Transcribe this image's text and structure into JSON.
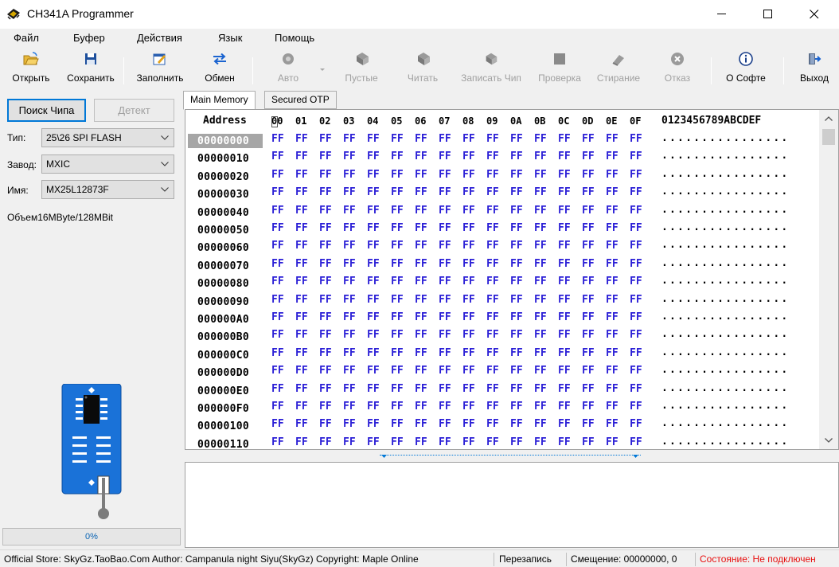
{
  "window": {
    "title": "CH341A Programmer"
  },
  "menu": [
    "Файл",
    "Буфер",
    "Действия",
    "Язык",
    "Помощь"
  ],
  "toolbar": {
    "open": "Открыть",
    "save": "Сохранить",
    "fill": "Заполнить",
    "swap": "Обмен",
    "auto": "Авто",
    "blank": "Пустые",
    "read": "Читать",
    "write": "Записать Чип",
    "verify": "Проверка",
    "erase": "Стирание",
    "cancel": "Отказ",
    "about": "О Софте",
    "exit": "Выход"
  },
  "chip": {
    "search_button": "Поиск Чипа",
    "detect_button": "Детект",
    "type_label": "Тип:",
    "type_value": "25\\26 SPI FLASH",
    "vendor_label": "Завод:",
    "vendor_value": "MXIC",
    "name_label": "Имя:",
    "name_value": "MX25L12873F",
    "capacity": "Объем16MByte/128MBit",
    "progress_text": "0%",
    "progress_fraction": 0
  },
  "tabs": [
    "Main Memory",
    "Secured OTP"
  ],
  "hex": {
    "address_header": "Address",
    "columns": [
      "00",
      "01",
      "02",
      "03",
      "04",
      "05",
      "06",
      "07",
      "08",
      "09",
      "0A",
      "0B",
      "0C",
      "0D",
      "0E",
      "0F"
    ],
    "ascii_header": "0123456789ABCDEF",
    "rows": [
      {
        "addr": "00000000",
        "ascii": "................"
      },
      {
        "addr": "00000010",
        "ascii": "................"
      },
      {
        "addr": "00000020",
        "ascii": "................"
      },
      {
        "addr": "00000030",
        "ascii": "................"
      },
      {
        "addr": "00000040",
        "ascii": "................"
      },
      {
        "addr": "00000050",
        "ascii": "................"
      },
      {
        "addr": "00000060",
        "ascii": "................"
      },
      {
        "addr": "00000070",
        "ascii": "................"
      },
      {
        "addr": "00000080",
        "ascii": "................"
      },
      {
        "addr": "00000090",
        "ascii": "................"
      },
      {
        "addr": "000000A0",
        "ascii": "................"
      },
      {
        "addr": "000000B0",
        "ascii": "................"
      },
      {
        "addr": "000000C0",
        "ascii": "................"
      },
      {
        "addr": "000000D0",
        "ascii": "................"
      },
      {
        "addr": "000000E0",
        "ascii": "................"
      },
      {
        "addr": "000000F0",
        "ascii": "................"
      },
      {
        "addr": "00000100",
        "ascii": "................"
      },
      {
        "addr": "00000110",
        "ascii": "................"
      }
    ],
    "byte_value": "FF",
    "byte_color": "#2a1ed6"
  },
  "status": {
    "info": "Official Store: SkyGz.TaoBao.Com Author: Campanula night Siyu(SkyGz) Copyright: Maple Online",
    "mode": "Перезапись",
    "offset": "Смещение: 00000000, 0",
    "state": "Состояние: Не подключен",
    "state_color": "#e81010"
  }
}
